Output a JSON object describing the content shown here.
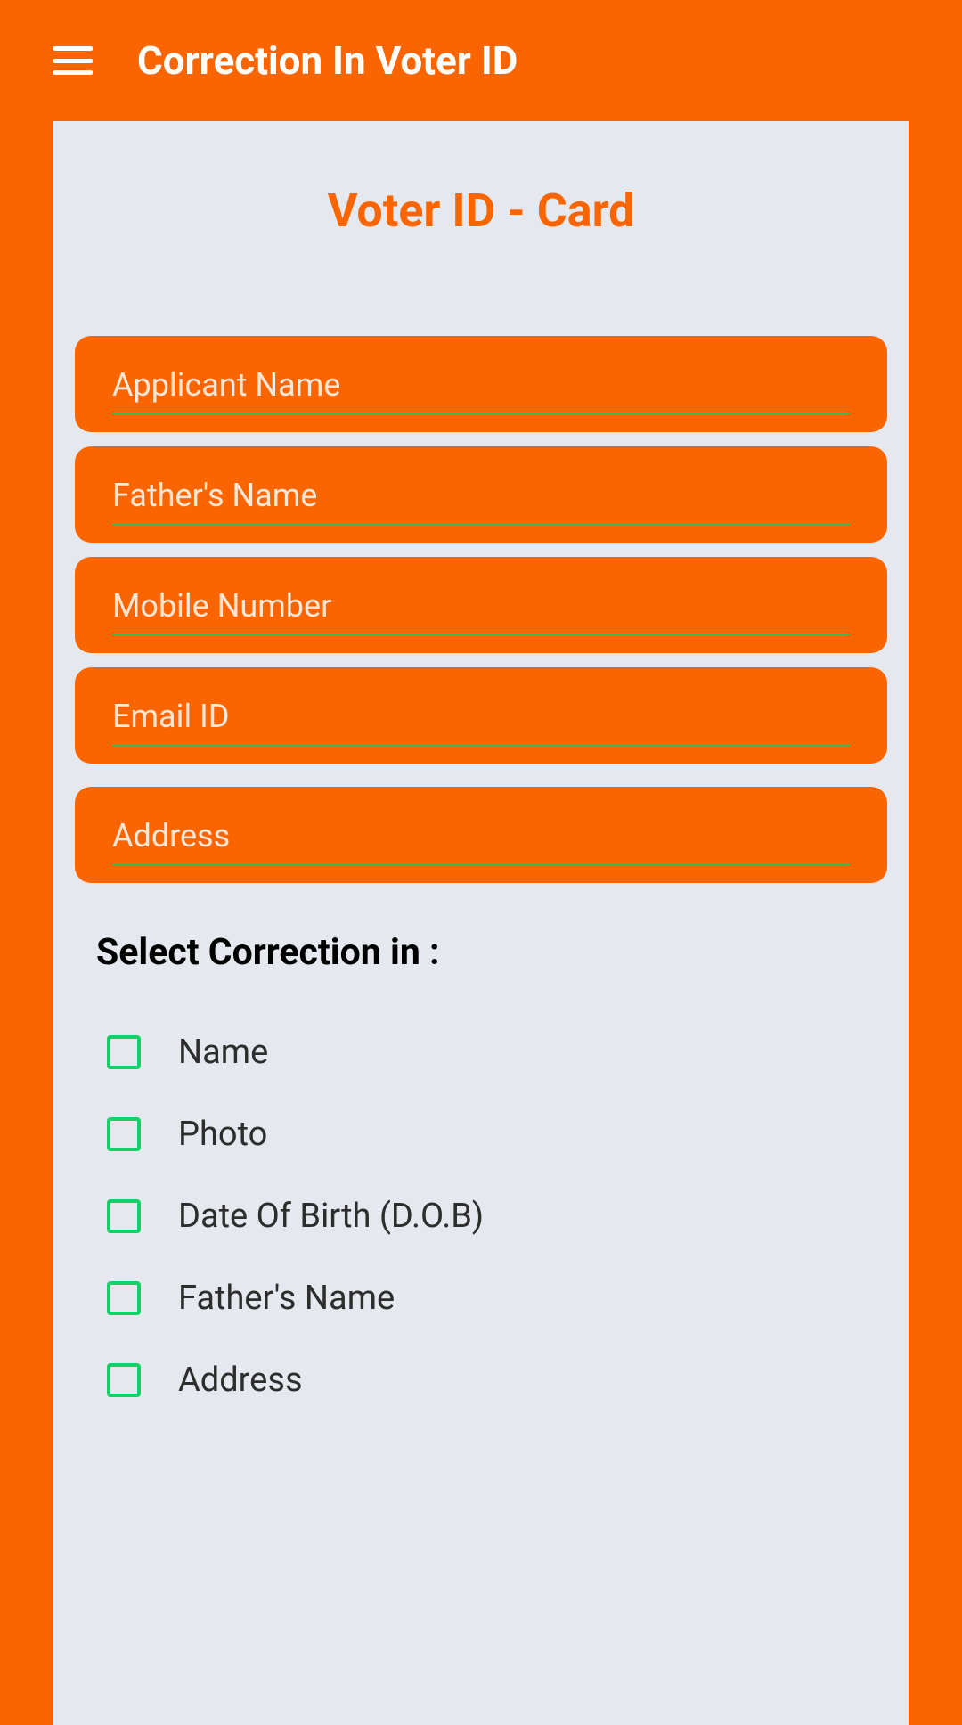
{
  "header": {
    "title": "Correction In Voter ID"
  },
  "page": {
    "title": "Voter ID - Card"
  },
  "form": {
    "fields": [
      {
        "placeholder": "Applicant Name",
        "name": "applicant-name"
      },
      {
        "placeholder": "Father's Name",
        "name": "fathers-name"
      },
      {
        "placeholder": "Mobile Number",
        "name": "mobile-number"
      },
      {
        "placeholder": "Email ID",
        "name": "email-id"
      },
      {
        "placeholder": "Address",
        "name": "address"
      }
    ]
  },
  "correction_section": {
    "label": "Select Correction in :",
    "options": [
      {
        "label": "Name",
        "name": "name"
      },
      {
        "label": "Photo",
        "name": "photo"
      },
      {
        "label": "Date Of Birth (D.O.B)",
        "name": "dob"
      },
      {
        "label": "Father's Name",
        "name": "fathers-name"
      },
      {
        "label": "Address",
        "name": "address"
      }
    ]
  }
}
